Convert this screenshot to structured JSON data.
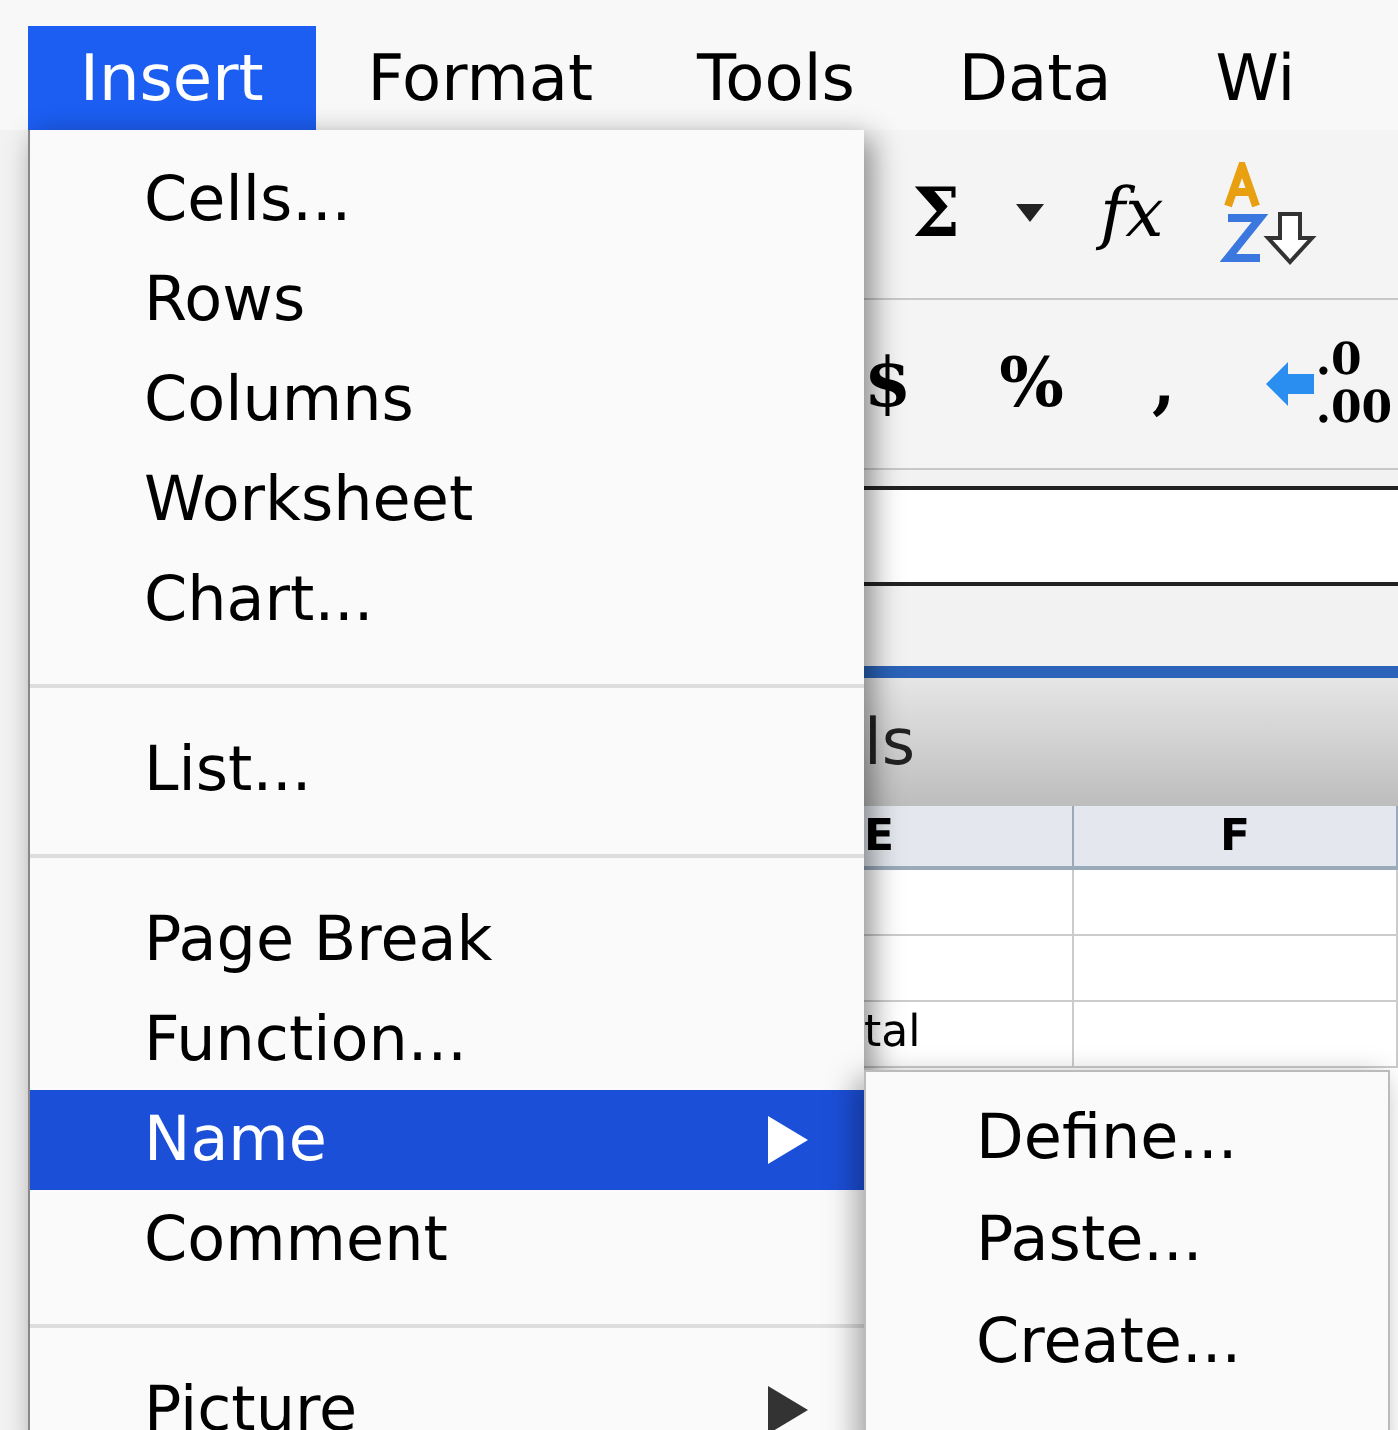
{
  "menubar": [
    {
      "label": "Insert",
      "selected": true
    },
    {
      "label": "Format",
      "selected": false
    },
    {
      "label": "Tools",
      "selected": false
    },
    {
      "label": "Data",
      "selected": false
    },
    {
      "label": "Wi",
      "selected": false
    }
  ],
  "toolbar_rows": [
    [
      {
        "kind": "text",
        "label": "Σ"
      },
      {
        "kind": "caret"
      },
      {
        "kind": "italic",
        "label": "fx"
      },
      {
        "kind": "sort"
      }
    ],
    [
      {
        "kind": "text",
        "label": "$"
      },
      {
        "kind": "text",
        "label": "%"
      },
      {
        "kind": "text",
        "label": ","
      },
      {
        "kind": "decimal",
        "label": ".0",
        "label2": ".00"
      }
    ]
  ],
  "window": {
    "title": "ls"
  },
  "sheet": {
    "columns": [
      "E",
      "F"
    ],
    "rows": [
      [
        "",
        ""
      ],
      [
        "",
        ""
      ],
      [
        "tal",
        ""
      ]
    ]
  },
  "menu": [
    {
      "kind": "item",
      "label": "Cells...",
      "selected": false,
      "submenu": false
    },
    {
      "kind": "item",
      "label": "Rows",
      "selected": false,
      "submenu": false
    },
    {
      "kind": "item",
      "label": "Columns",
      "selected": false,
      "submenu": false
    },
    {
      "kind": "item",
      "label": "Worksheet",
      "selected": false,
      "submenu": false
    },
    {
      "kind": "item",
      "label": "Chart...",
      "selected": false,
      "submenu": false
    },
    {
      "kind": "separator"
    },
    {
      "kind": "item",
      "label": "List...",
      "selected": false,
      "submenu": false
    },
    {
      "kind": "separator"
    },
    {
      "kind": "item",
      "label": "Page Break",
      "selected": false,
      "submenu": false
    },
    {
      "kind": "item",
      "label": "Function...",
      "selected": false,
      "submenu": false
    },
    {
      "kind": "item",
      "label": "Name",
      "selected": true,
      "submenu": true
    },
    {
      "kind": "item",
      "label": "Comment",
      "selected": false,
      "submenu": false
    },
    {
      "kind": "separator"
    },
    {
      "kind": "item",
      "label": "Picture",
      "selected": false,
      "submenu": true
    }
  ],
  "submenu": [
    {
      "label": "Define..."
    },
    {
      "label": "Paste..."
    },
    {
      "label": "Create..."
    }
  ]
}
